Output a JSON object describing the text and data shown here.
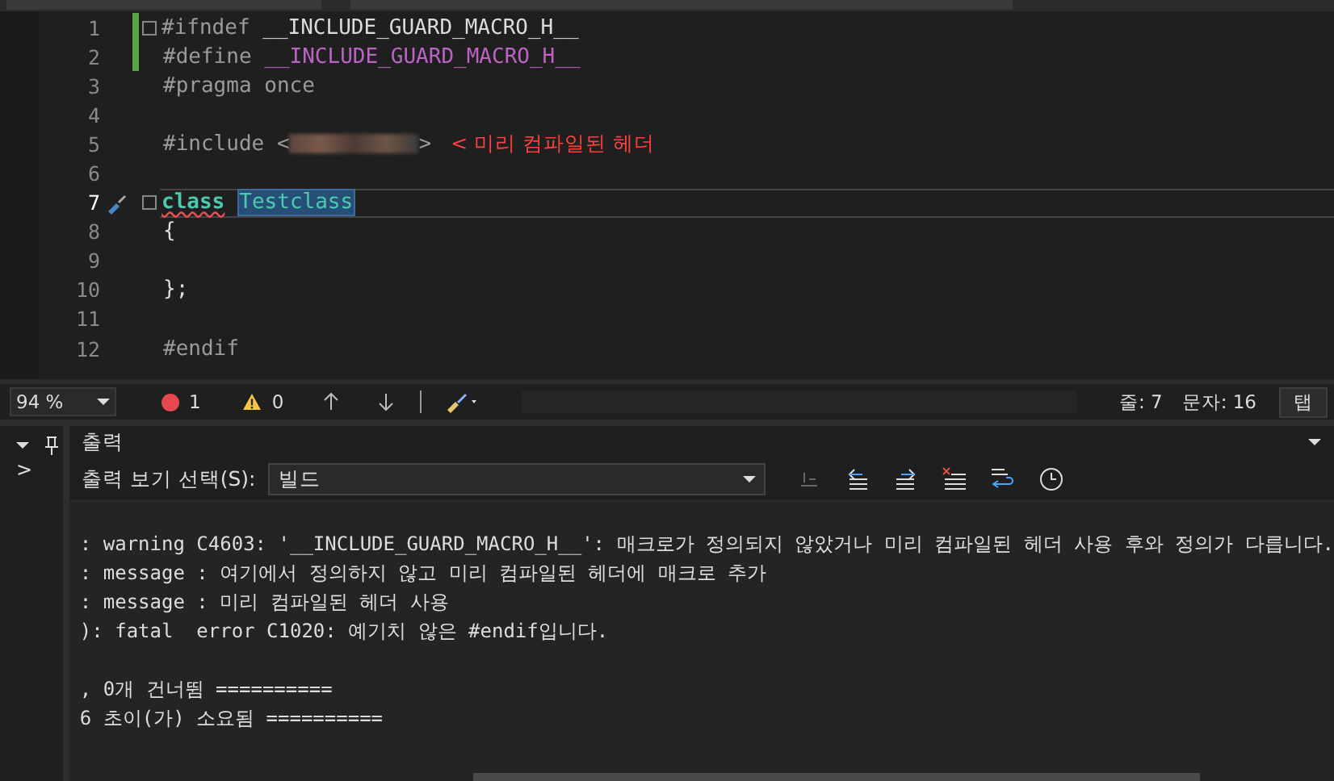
{
  "editor": {
    "lines": [
      {
        "number": "1",
        "modified": true,
        "current": false,
        "fold": true,
        "tokens": [
          {
            "kind": "preproc",
            "text": "#ifndef "
          },
          {
            "kind": "plain",
            "text": "__INCLUDE_GUARD_MACRO_H__"
          }
        ]
      },
      {
        "number": "2",
        "modified": true,
        "current": false,
        "fold": false,
        "tokens": [
          {
            "kind": "preproc",
            "text": "#define "
          },
          {
            "kind": "macro",
            "text": "__INCLUDE_GUARD_MACRO_H__"
          }
        ]
      },
      {
        "number": "3",
        "modified": false,
        "current": false,
        "fold": false,
        "tokens": [
          {
            "kind": "preproc",
            "text": "#pragma once"
          }
        ]
      },
      {
        "number": "4",
        "modified": false,
        "current": false,
        "fold": false
      },
      {
        "number": "5",
        "modified": false,
        "current": false,
        "fold": false,
        "tokens": [
          {
            "kind": "preproc",
            "text": "#include <"
          },
          {
            "kind": "blurred"
          },
          {
            "kind": "preproc",
            "text": ">"
          },
          {
            "kind": "annotation",
            "text": "< 미리 컴파일된 헤더"
          }
        ]
      },
      {
        "number": "6",
        "modified": false,
        "current": false,
        "fold": false
      },
      {
        "number": "7",
        "modified": false,
        "current": true,
        "fold": true,
        "tokens": [
          {
            "kind": "keyword",
            "text": "class"
          },
          {
            "kind": "type",
            "text": "Testclass"
          }
        ]
      },
      {
        "number": "8",
        "modified": false,
        "current": false,
        "fold": false,
        "tokens": [
          {
            "kind": "plain",
            "text": "{"
          }
        ]
      },
      {
        "number": "9",
        "modified": false,
        "current": false,
        "fold": false
      },
      {
        "number": "10",
        "modified": false,
        "current": false,
        "fold": false,
        "tokens": [
          {
            "kind": "plain",
            "text": "};"
          }
        ]
      },
      {
        "number": "11",
        "modified": false,
        "current": false,
        "fold": false
      },
      {
        "number": "12",
        "modified": false,
        "current": false,
        "fold": false,
        "tokens": [
          {
            "kind": "preproc",
            "text": "#endif"
          }
        ]
      }
    ]
  },
  "status_bar": {
    "zoom": "94 %",
    "errors": "1",
    "warnings": "0",
    "line": "줄: 7",
    "column": "문자: 16",
    "indent": "탭"
  },
  "side_panel": {
    "text": ">"
  },
  "output": {
    "title": "출력",
    "source_label": "출력 보기 선택(S):",
    "source_value": "빌드",
    "blocks": [
      [
        ": warning C4603: '__INCLUDE_GUARD_MACRO_H__': 매크로가 정의되지 않았거나 미리 컴파일된 헤더 사용 후와 정의가 다릅니다.",
        ": message : 여기에서 정의하지 않고 미리 컴파일된 헤더에 매크로 추가",
        ": message : 미리 컴파일된 헤더 사용",
        "): fatal  error C1020: 예기치 않은 #endif입니다."
      ],
      [
        ", 0개 건너뜀 ==========",
        "6 초이(가) 소요됨 =========="
      ]
    ]
  }
}
